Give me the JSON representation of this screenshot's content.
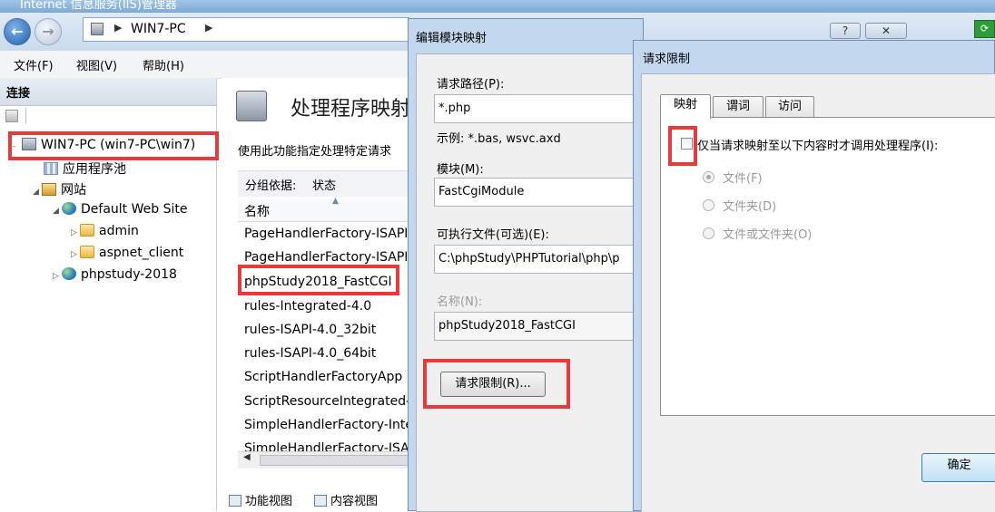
{
  "window": {
    "title": "Internet 信息服务(IIS)管理器"
  },
  "address": {
    "path_item": "WIN7-PC"
  },
  "menu": {
    "file": "文件(F)",
    "view": "视图(V)",
    "help": "帮助(H)"
  },
  "connections": {
    "header": "连接",
    "tree": [
      {
        "label": "WIN7-PC (win7-PC\\win7)",
        "icon": "server-icon"
      },
      {
        "label": "应用程序池",
        "icon": "app-pools-icon"
      },
      {
        "label": "网站",
        "icon": "sites-folder-icon"
      },
      {
        "label": "Default Web Site",
        "icon": "globe-icon"
      },
      {
        "label": "admin",
        "icon": "folder-icon"
      },
      {
        "label": "aspnet_client",
        "icon": "folder-icon"
      },
      {
        "label": "phpstudy-2018",
        "icon": "globe-icon"
      }
    ]
  },
  "feature": {
    "title": "处理程序映射",
    "description": "使用此功能指定处理特定请求",
    "group_by_label": "分组依据:",
    "group_by_value": "状态",
    "column_name": "名称",
    "rows": [
      "PageHandlerFactory-ISAPI",
      "PageHandlerFactory-ISAPI",
      "phpStudy2018_FastCGI",
      "rules-Integrated-4.0",
      "rules-ISAPI-4.0_32bit",
      "rules-ISAPI-4.0_64bit",
      "ScriptHandlerFactoryApp",
      "ScriptResourceIntegrated-",
      "SimpleHandlerFactory-Inte",
      "SimpleHandlerFactory-ISA"
    ],
    "tab_features": "功能视图",
    "tab_content": "内容视图"
  },
  "edit_module_dialog": {
    "title": "编辑模块映射",
    "help_button": "?",
    "close_button": "✕",
    "request_path_label": "请求路径(P):",
    "request_path_value": "*.php",
    "example_text": "示例: *.bas, wsvc.axd",
    "module_label": "模块(M):",
    "module_value": "FastCgiModule",
    "executable_label": "可执行文件(可选)(E):",
    "executable_value": "C:\\phpStudy\\PHPTutorial\\php\\p",
    "name_label": "名称(N):",
    "name_value": "phpStudy2018_FastCGI",
    "request_restrictions_button": "请求限制(R)..."
  },
  "restrictions_dialog": {
    "title": "请求限制",
    "tabs": [
      "映射",
      "谓词",
      "访问"
    ],
    "checkbox_label": "仅当请求映射至以下内容时才调用处理程序(I):",
    "checkbox_checked": false,
    "radio_options": [
      "文件(F)",
      "文件夹(D)",
      "文件或文件夹(O)"
    ],
    "selected_radio": "文件(F)",
    "ok_button": "确定"
  },
  "colors": {
    "highlight": "#e83a3a",
    "dialog_frame": "#c3d8ef"
  }
}
